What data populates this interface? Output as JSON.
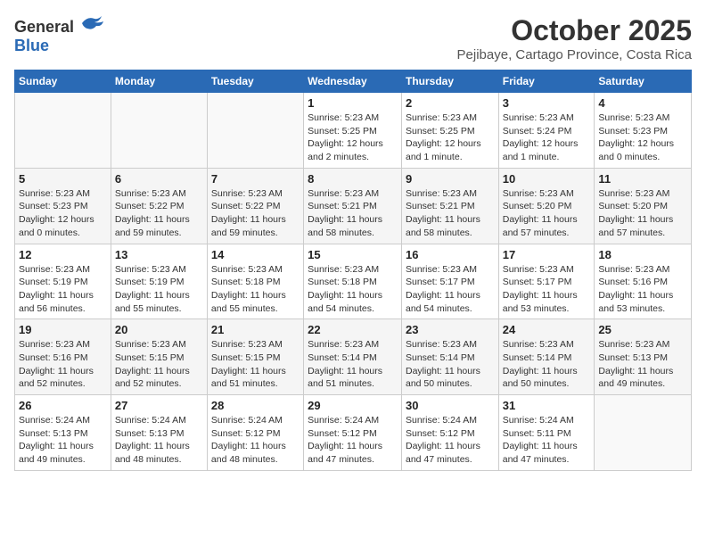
{
  "header": {
    "logo_general": "General",
    "logo_blue": "Blue",
    "month_title": "October 2025",
    "subtitle": "Pejibaye, Cartago Province, Costa Rica"
  },
  "weekdays": [
    "Sunday",
    "Monday",
    "Tuesday",
    "Wednesday",
    "Thursday",
    "Friday",
    "Saturday"
  ],
  "weeks": [
    [
      {
        "day": "",
        "info": ""
      },
      {
        "day": "",
        "info": ""
      },
      {
        "day": "",
        "info": ""
      },
      {
        "day": "1",
        "info": "Sunrise: 5:23 AM\nSunset: 5:25 PM\nDaylight: 12 hours\nand 2 minutes."
      },
      {
        "day": "2",
        "info": "Sunrise: 5:23 AM\nSunset: 5:25 PM\nDaylight: 12 hours\nand 1 minute."
      },
      {
        "day": "3",
        "info": "Sunrise: 5:23 AM\nSunset: 5:24 PM\nDaylight: 12 hours\nand 1 minute."
      },
      {
        "day": "4",
        "info": "Sunrise: 5:23 AM\nSunset: 5:23 PM\nDaylight: 12 hours\nand 0 minutes."
      }
    ],
    [
      {
        "day": "5",
        "info": "Sunrise: 5:23 AM\nSunset: 5:23 PM\nDaylight: 12 hours\nand 0 minutes."
      },
      {
        "day": "6",
        "info": "Sunrise: 5:23 AM\nSunset: 5:22 PM\nDaylight: 11 hours\nand 59 minutes."
      },
      {
        "day": "7",
        "info": "Sunrise: 5:23 AM\nSunset: 5:22 PM\nDaylight: 11 hours\nand 59 minutes."
      },
      {
        "day": "8",
        "info": "Sunrise: 5:23 AM\nSunset: 5:21 PM\nDaylight: 11 hours\nand 58 minutes."
      },
      {
        "day": "9",
        "info": "Sunrise: 5:23 AM\nSunset: 5:21 PM\nDaylight: 11 hours\nand 58 minutes."
      },
      {
        "day": "10",
        "info": "Sunrise: 5:23 AM\nSunset: 5:20 PM\nDaylight: 11 hours\nand 57 minutes."
      },
      {
        "day": "11",
        "info": "Sunrise: 5:23 AM\nSunset: 5:20 PM\nDaylight: 11 hours\nand 57 minutes."
      }
    ],
    [
      {
        "day": "12",
        "info": "Sunrise: 5:23 AM\nSunset: 5:19 PM\nDaylight: 11 hours\nand 56 minutes."
      },
      {
        "day": "13",
        "info": "Sunrise: 5:23 AM\nSunset: 5:19 PM\nDaylight: 11 hours\nand 55 minutes."
      },
      {
        "day": "14",
        "info": "Sunrise: 5:23 AM\nSunset: 5:18 PM\nDaylight: 11 hours\nand 55 minutes."
      },
      {
        "day": "15",
        "info": "Sunrise: 5:23 AM\nSunset: 5:18 PM\nDaylight: 11 hours\nand 54 minutes."
      },
      {
        "day": "16",
        "info": "Sunrise: 5:23 AM\nSunset: 5:17 PM\nDaylight: 11 hours\nand 54 minutes."
      },
      {
        "day": "17",
        "info": "Sunrise: 5:23 AM\nSunset: 5:17 PM\nDaylight: 11 hours\nand 53 minutes."
      },
      {
        "day": "18",
        "info": "Sunrise: 5:23 AM\nSunset: 5:16 PM\nDaylight: 11 hours\nand 53 minutes."
      }
    ],
    [
      {
        "day": "19",
        "info": "Sunrise: 5:23 AM\nSunset: 5:16 PM\nDaylight: 11 hours\nand 52 minutes."
      },
      {
        "day": "20",
        "info": "Sunrise: 5:23 AM\nSunset: 5:15 PM\nDaylight: 11 hours\nand 52 minutes."
      },
      {
        "day": "21",
        "info": "Sunrise: 5:23 AM\nSunset: 5:15 PM\nDaylight: 11 hours\nand 51 minutes."
      },
      {
        "day": "22",
        "info": "Sunrise: 5:23 AM\nSunset: 5:14 PM\nDaylight: 11 hours\nand 51 minutes."
      },
      {
        "day": "23",
        "info": "Sunrise: 5:23 AM\nSunset: 5:14 PM\nDaylight: 11 hours\nand 50 minutes."
      },
      {
        "day": "24",
        "info": "Sunrise: 5:23 AM\nSunset: 5:14 PM\nDaylight: 11 hours\nand 50 minutes."
      },
      {
        "day": "25",
        "info": "Sunrise: 5:23 AM\nSunset: 5:13 PM\nDaylight: 11 hours\nand 49 minutes."
      }
    ],
    [
      {
        "day": "26",
        "info": "Sunrise: 5:24 AM\nSunset: 5:13 PM\nDaylight: 11 hours\nand 49 minutes."
      },
      {
        "day": "27",
        "info": "Sunrise: 5:24 AM\nSunset: 5:13 PM\nDaylight: 11 hours\nand 48 minutes."
      },
      {
        "day": "28",
        "info": "Sunrise: 5:24 AM\nSunset: 5:12 PM\nDaylight: 11 hours\nand 48 minutes."
      },
      {
        "day": "29",
        "info": "Sunrise: 5:24 AM\nSunset: 5:12 PM\nDaylight: 11 hours\nand 47 minutes."
      },
      {
        "day": "30",
        "info": "Sunrise: 5:24 AM\nSunset: 5:12 PM\nDaylight: 11 hours\nand 47 minutes."
      },
      {
        "day": "31",
        "info": "Sunrise: 5:24 AM\nSunset: 5:11 PM\nDaylight: 11 hours\nand 47 minutes."
      },
      {
        "day": "",
        "info": ""
      }
    ]
  ]
}
